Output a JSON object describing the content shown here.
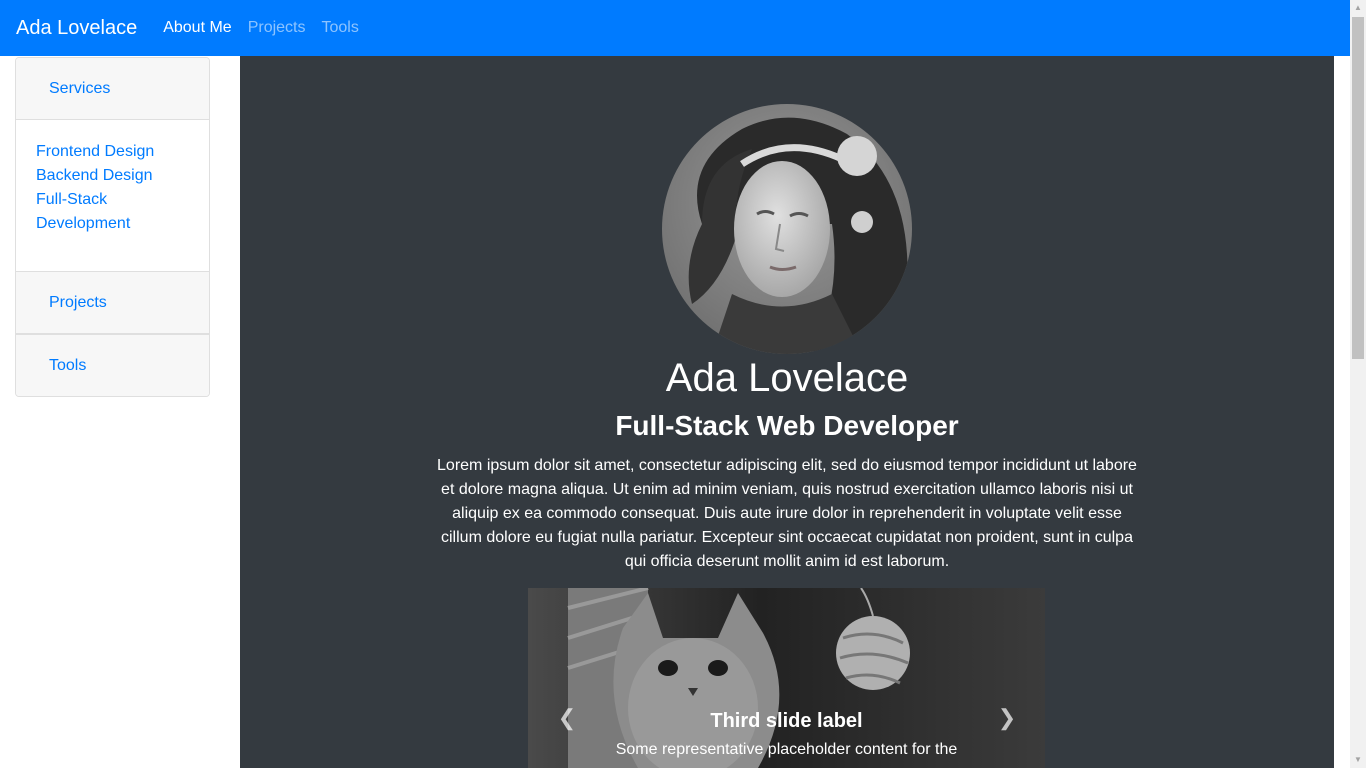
{
  "navbar": {
    "brand": "Ada Lovelace",
    "links": [
      {
        "label": "About Me",
        "active": true
      },
      {
        "label": "Projects",
        "active": false
      },
      {
        "label": "Tools",
        "active": false
      }
    ]
  },
  "sidebar": {
    "sections": [
      {
        "header": "Services",
        "items": [
          "Frontend Design",
          "Backend Design",
          "Full-Stack Development"
        ]
      },
      {
        "header": "Projects",
        "items": []
      },
      {
        "header": "Tools",
        "items": []
      }
    ]
  },
  "profile": {
    "name": "Ada Lovelace",
    "role": "Full-Stack Web Developer",
    "bio": "Lorem ipsum dolor sit amet, consectetur adipiscing elit, sed do eiusmod tempor incididunt ut labore et dolore magna aliqua. Ut enim ad minim veniam, quis nostrud exercitation ullamco laboris nisi ut aliquip ex ea commodo consequat. Duis aute irure dolor in reprehenderit in voluptate velit esse cillum dolore eu fugiat nulla pariatur. Excepteur sint occaecat cupidatat non proident, sunt in culpa qui officia deserunt mollit anim id est laborum."
  },
  "carousel": {
    "caption_title": "Third slide label",
    "caption_text": "Some representative placeholder content for the",
    "prev_icon": "chevron-left-icon",
    "next_icon": "chevron-right-icon"
  },
  "colors": {
    "primary": "#007bff",
    "dark": "#343a40"
  }
}
